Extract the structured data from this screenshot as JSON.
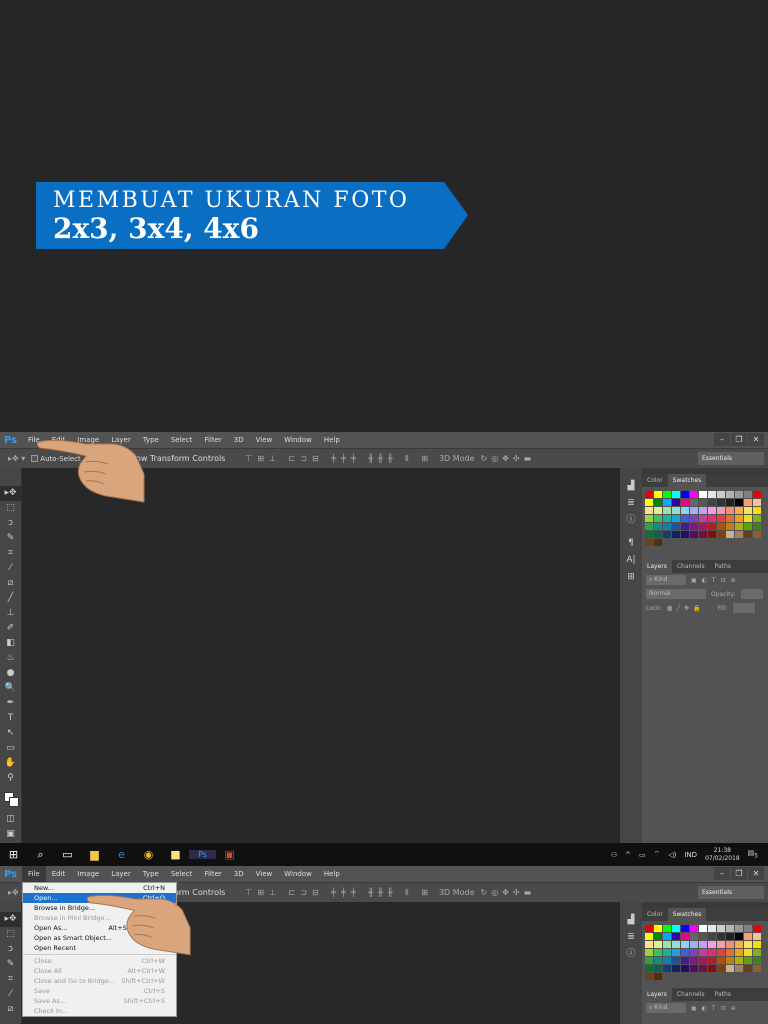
{
  "banner": {
    "line1": "MEMBUAT UKURAN FOTO",
    "line2": "2x3, 3x4, 4x6"
  },
  "ps": {
    "logo": "Ps",
    "menus": [
      "File",
      "Edit",
      "Image",
      "Layer",
      "Type",
      "Select",
      "Filter",
      "3D",
      "View",
      "Window",
      "Help"
    ],
    "window_buttons": [
      "–",
      "❐",
      "✕"
    ],
    "options": {
      "auto_select": "Auto-Select",
      "show_transform": "Show Transform Controls",
      "mode_3d": "3D Mode",
      "workspace": "Essentials"
    },
    "panels": {
      "color_tab": "Color",
      "swatches_tab": "Swatches",
      "layers_tab": "Layers",
      "channels_tab": "Channels",
      "paths_tab": "Paths",
      "kind": "Kind",
      "blend": "Normal",
      "opacity_label": "Opacity:",
      "lock_label": "Lock:",
      "fill_label": "Fill:"
    }
  },
  "taskbar": {
    "time": "21:38",
    "date": "07/02/2018",
    "lang": "IND",
    "notif_count": "5"
  },
  "file_menu": [
    {
      "label": "New...",
      "shortcut": "Ctrl+N",
      "state": "normal"
    },
    {
      "label": "Open...",
      "shortcut": "Ctrl+O",
      "state": "hover"
    },
    {
      "label": "Browse in Bridge...",
      "shortcut": "",
      "state": "normal"
    },
    {
      "label": "Browse in Mini Bridge...",
      "shortcut": "",
      "state": "disabled"
    },
    {
      "label": "Open As...",
      "shortcut": "Alt+Shift+Ctrl+O",
      "state": "normal"
    },
    {
      "label": "Open as Smart Object...",
      "shortcut": "",
      "state": "normal"
    },
    {
      "label": "Open Recent",
      "shortcut": "",
      "state": "normal"
    },
    {
      "label": "Close",
      "shortcut": "Ctrl+W",
      "state": "disabled"
    },
    {
      "label": "Close All",
      "shortcut": "Alt+Ctrl+W",
      "state": "disabled"
    },
    {
      "label": "Close and Go to Bridge...",
      "shortcut": "Shift+Ctrl+W",
      "state": "disabled"
    },
    {
      "label": "Save",
      "shortcut": "Ctrl+S",
      "state": "disabled"
    },
    {
      "label": "Save As...",
      "shortcut": "Shift+Ctrl+S",
      "state": "disabled"
    },
    {
      "label": "Check In...",
      "shortcut": "",
      "state": "disabled"
    }
  ],
  "colors": {
    "accent": "#0a6ec2",
    "menu_highlight": "#1a73d1"
  }
}
